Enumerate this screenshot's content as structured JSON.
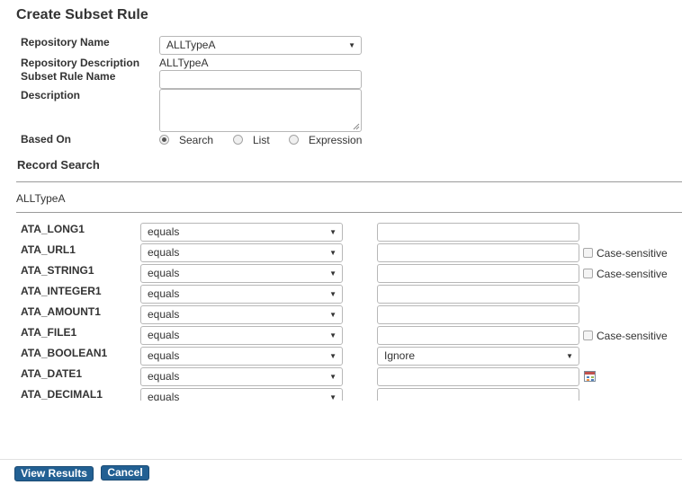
{
  "page": {
    "title": "Create Subset Rule"
  },
  "form": {
    "repository_name_label": "Repository Name",
    "repository_name_value": "ALLTypeA",
    "repository_description_label": "Repository Description",
    "repository_description_value": "ALLTypeA",
    "subset_rule_name_label": "Subset Rule Name",
    "subset_rule_name_value": "",
    "description_label": "Description",
    "description_value": "",
    "based_on_label": "Based On",
    "based_on_options": [
      {
        "label": "Search",
        "selected": true
      },
      {
        "label": "List",
        "selected": false
      },
      {
        "label": "Expression",
        "selected": false
      }
    ]
  },
  "record_search": {
    "heading": "Record Search",
    "repository": "ALLTypeA",
    "case_sensitive_label": "Case-sensitive",
    "rows": [
      {
        "field": "ATA_LONG1",
        "operator": "equals",
        "value": "",
        "case_sensitive": false,
        "has_case": false
      },
      {
        "field": "ATA_URL1",
        "operator": "equals",
        "value": "",
        "case_sensitive": false,
        "has_case": true
      },
      {
        "field": "ATA_STRING1",
        "operator": "equals",
        "value": "",
        "case_sensitive": false,
        "has_case": true
      },
      {
        "field": "ATA_INTEGER1",
        "operator": "equals",
        "value": "",
        "case_sensitive": false,
        "has_case": false
      },
      {
        "field": "ATA_AMOUNT1",
        "operator": "equals",
        "value": "",
        "case_sensitive": false,
        "has_case": false
      },
      {
        "field": "ATA_FILE1",
        "operator": "equals",
        "value": "",
        "case_sensitive": false,
        "has_case": true
      },
      {
        "field": "ATA_BOOLEAN1",
        "operator": "equals",
        "value": "Ignore",
        "is_select": true
      },
      {
        "field": "ATA_DATE1",
        "operator": "equals",
        "value": "",
        "has_calendar": true
      },
      {
        "field": "ATA_DECIMAL1",
        "operator": "equals",
        "value": ""
      }
    ]
  },
  "buttons": {
    "view_results": "View Results",
    "cancel": "Cancel"
  },
  "colors": {
    "button_bg": "#226093",
    "text": "#333333",
    "divider": "#9a9a9a"
  }
}
